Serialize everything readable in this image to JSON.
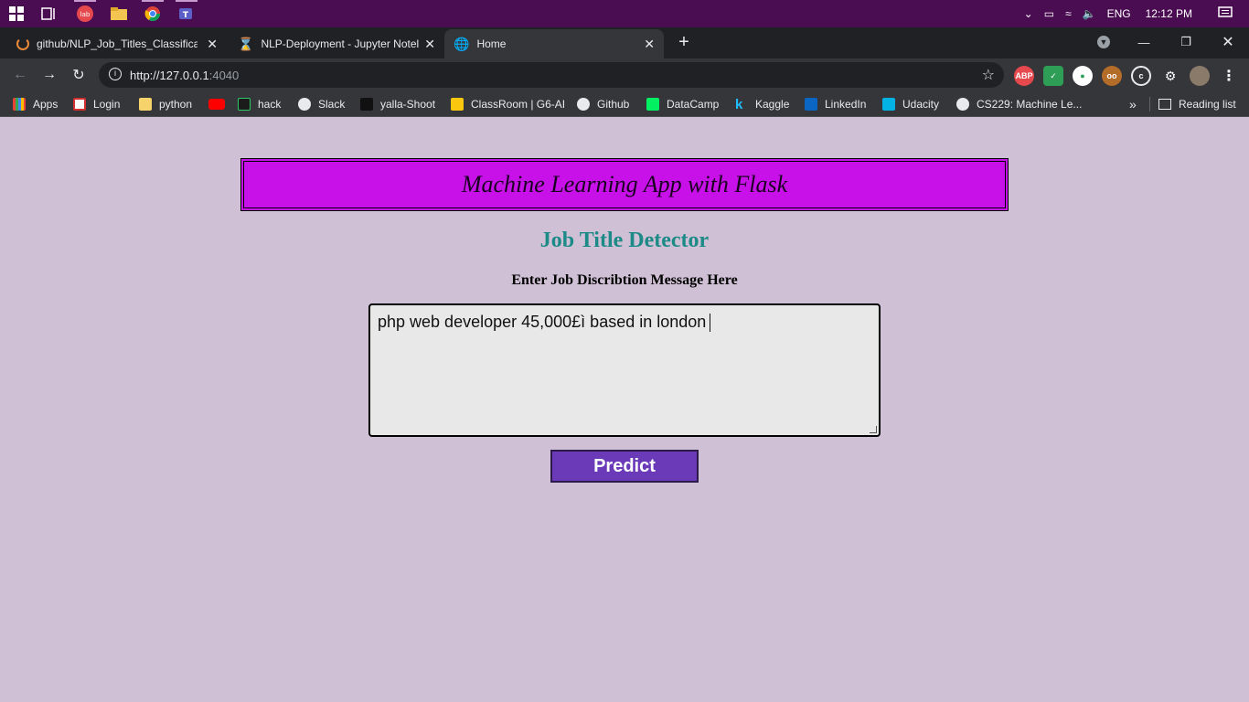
{
  "taskbar": {
    "time": "12:12 PM",
    "language": "ENG",
    "apps": [
      "windows-start",
      "task-view",
      "brave-app",
      "file-explorer",
      "chrome",
      "teams"
    ]
  },
  "tabs": [
    {
      "title": "github/NLP_Job_Titles_Classificat",
      "icon": "github-spinner-icon"
    },
    {
      "title": "NLP-Deployment - Jupyter Notel",
      "icon": "jupyter-icon"
    },
    {
      "title": "Home",
      "icon": "globe-icon"
    }
  ],
  "toolbar": {
    "url_host": "http://127.0.0.1",
    "url_port": ":4040"
  },
  "bookmarks": [
    {
      "label": "Apps",
      "color": "#ea4335"
    },
    {
      "label": "Login",
      "color": "#d32f2f"
    },
    {
      "label": "python",
      "color": "#f6d36b"
    },
    {
      "label": "",
      "color": "#ff0000"
    },
    {
      "label": "hack",
      "color": "#1b1b1b"
    },
    {
      "label": "Slack",
      "color": "#e8eaed"
    },
    {
      "label": "yalla-Shoot",
      "color": "#111111"
    },
    {
      "label": "ClassRoom | G6-AI",
      "color": "#f9c80e"
    },
    {
      "label": "Github",
      "color": "#e8eaed"
    },
    {
      "label": "DataCamp",
      "color": "#03ef62"
    },
    {
      "label": "Kaggle",
      "color": "#20beff"
    },
    {
      "label": "LinkedIn",
      "color": "#0a66c2"
    },
    {
      "label": "Udacity",
      "color": "#02b3e4"
    },
    {
      "label": "CS229: Machine Le...",
      "color": "#e8eaed"
    }
  ],
  "reading_list": "Reading list",
  "page": {
    "banner_title": "Machine Learning App with Flask",
    "title": "Job Title Detector",
    "field_label": "Enter Job Discribtion Message Here",
    "message_value": "php web developer 45,000£ì based in london",
    "predict_label": "Predict"
  },
  "colors": {
    "page_bg": "#cfc0d5",
    "banner_bg": "#c711e8",
    "title_color": "#1c8a86",
    "button_bg": "#6a3ab8",
    "taskbar_bg": "#4b0d52"
  }
}
